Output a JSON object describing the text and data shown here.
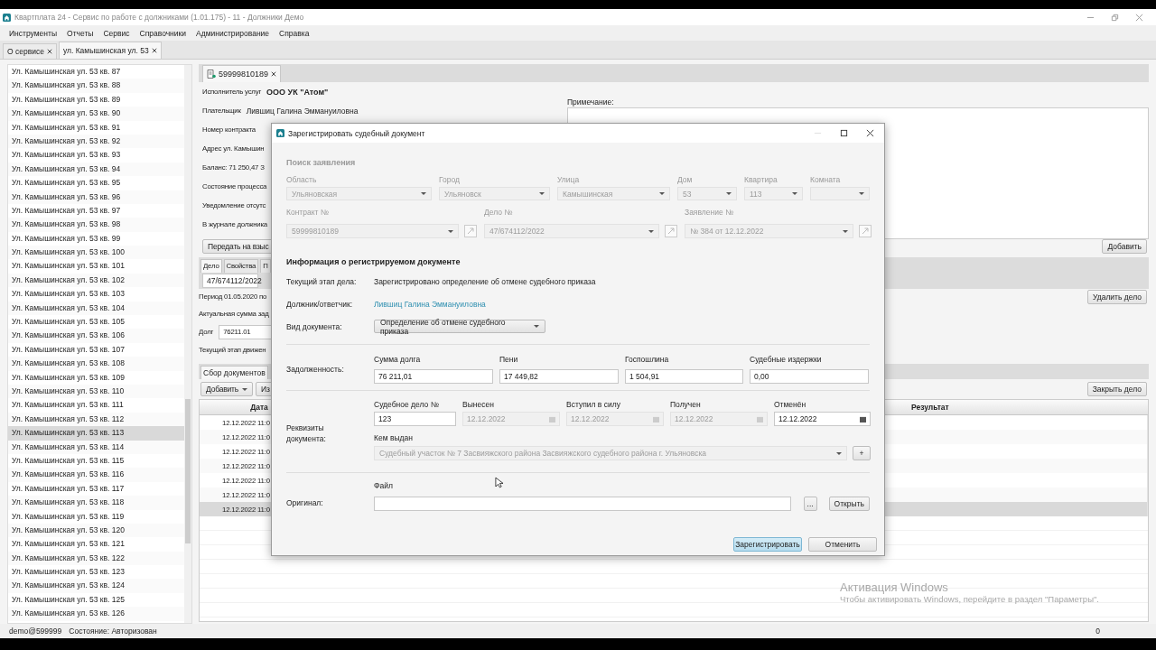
{
  "window": {
    "title": "Квартплата 24 - Сервис по работе с должниками (1.01.175) - 11 - Должники Демо",
    "menu": [
      "Инструменты",
      "Отчеты",
      "Сервис",
      "Справочники",
      "Администрирование",
      "Справка"
    ]
  },
  "tabs": [
    {
      "label": "О сервисе",
      "selected": false
    },
    {
      "label": "ул. Камышинская ул. 53",
      "selected": true
    }
  ],
  "address_list": [
    {
      "label": "Ул. Камышинская ул. 53 кв. 87",
      "selected": false
    },
    {
      "label": "Ул. Камышинская ул. 53 кв. 88",
      "selected": false
    },
    {
      "label": "Ул. Камышинская ул. 53 кв. 89",
      "selected": false
    },
    {
      "label": "Ул. Камышинская ул. 53 кв. 90",
      "selected": false
    },
    {
      "label": "Ул. Камышинская ул. 53 кв. 91",
      "selected": false
    },
    {
      "label": "Ул. Камышинская ул. 53 кв. 92",
      "selected": false
    },
    {
      "label": "Ул. Камышинская ул. 53 кв. 93",
      "selected": false
    },
    {
      "label": "Ул. Камышинская ул. 53 кв. 94",
      "selected": false
    },
    {
      "label": "Ул. Камышинская ул. 53 кв. 95",
      "selected": false
    },
    {
      "label": "Ул. Камышинская ул. 53 кв. 96",
      "selected": false
    },
    {
      "label": "Ул. Камышинская ул. 53 кв. 97",
      "selected": false
    },
    {
      "label": "Ул. Камышинская ул. 53 кв. 98",
      "selected": false
    },
    {
      "label": "Ул. Камышинская ул. 53 кв. 99",
      "selected": false
    },
    {
      "label": "Ул. Камышинская ул. 53 кв. 100",
      "selected": false
    },
    {
      "label": "Ул. Камышинская ул. 53 кв. 101",
      "selected": false
    },
    {
      "label": "Ул. Камышинская ул. 53 кв. 102",
      "selected": false
    },
    {
      "label": "Ул. Камышинская ул. 53 кв. 103",
      "selected": false
    },
    {
      "label": "Ул. Камышинская ул. 53 кв. 104",
      "selected": false
    },
    {
      "label": "Ул. Камышинская ул. 53 кв. 105",
      "selected": false
    },
    {
      "label": "Ул. Камышинская ул. 53 кв. 106",
      "selected": false
    },
    {
      "label": "Ул. Камышинская ул. 53 кв. 107",
      "selected": false
    },
    {
      "label": "Ул. Камышинская ул. 53 кв. 108",
      "selected": false
    },
    {
      "label": "Ул. Камышинская ул. 53 кв. 109",
      "selected": false
    },
    {
      "label": "Ул. Камышинская ул. 53 кв. 110",
      "selected": false
    },
    {
      "label": "Ул. Камышинская ул. 53 кв. 111",
      "selected": false
    },
    {
      "label": "Ул. Камышинская ул. 53 кв. 112",
      "selected": false
    },
    {
      "label": "Ул. Камышинская ул. 53 кв. 113",
      "selected": true
    },
    {
      "label": "Ул. Камышинская ул. 53 кв. 114",
      "selected": false
    },
    {
      "label": "Ул. Камышинская ул. 53 кв. 115",
      "selected": false
    },
    {
      "label": "Ул. Камышинская ул. 53 кв. 116",
      "selected": false
    },
    {
      "label": "Ул. Камышинская ул. 53 кв. 117",
      "selected": false
    },
    {
      "label": "Ул. Камышинская ул. 53 кв. 118",
      "selected": false
    },
    {
      "label": "Ул. Камышинская ул. 53 кв. 119",
      "selected": false
    },
    {
      "label": "Ул. Камышинская ул. 53 кв. 120",
      "selected": false
    },
    {
      "label": "Ул. Камышинская ул. 53 кв. 121",
      "selected": false
    },
    {
      "label": "Ул. Камышинская ул. 53 кв. 122",
      "selected": false
    },
    {
      "label": "Ул. Камышинская ул. 53 кв. 123",
      "selected": false
    },
    {
      "label": "Ул. Камышинская ул. 53 кв. 124",
      "selected": false
    },
    {
      "label": "Ул. Камышинская ул. 53 кв. 125",
      "selected": false
    },
    {
      "label": "Ул. Камышинская ул. 53 кв. 126",
      "selected": false
    }
  ],
  "document_tab": {
    "label": "59999810189"
  },
  "info_lines": [
    {
      "label": "Исполнитель услуг",
      "value": "ООО УК \"Атом\""
    },
    {
      "label": "Плательщик",
      "value": "Лившиц Галина Эммануиловна"
    },
    {
      "label": "Номер контракта"
    },
    {
      "label": "Адрес  ул. Камышин"
    },
    {
      "label": "Баланс: 71 250,47  З"
    },
    {
      "label": "Состояние процесса"
    },
    {
      "label": "Уведомление отсутс"
    },
    {
      "label": "В журнале должника"
    }
  ],
  "send_button": "Передать на взыс",
  "note": {
    "label": "Примечание:",
    "add_button": "Добавить"
  },
  "case_tabs": [
    {
      "label": "Дело",
      "selected": true
    },
    {
      "label": "Свойства",
      "selected": false
    },
    {
      "label": "П",
      "selected": false
    }
  ],
  "case_number": "47/674112/2022",
  "period": "Период  01.05.2020  по",
  "delete_button": "Удалить дело",
  "actual_sum": "Актуальная сумма зад",
  "debt": {
    "label": "Долг",
    "value": "76211.01"
  },
  "stage": "Текущий этап движен",
  "stage_tabs": [
    {
      "label": "Сбор документов",
      "selected": true
    }
  ],
  "toolbar": {
    "add": "Добавить",
    "edit": "Из",
    "close_case": "Закрыть дело"
  },
  "table": {
    "date_header": "Дата",
    "result_header": "Результат",
    "rows": [
      {
        "date": "12.12.2022 11:0",
        "selected": false
      },
      {
        "date": "12.12.2022 11:0",
        "selected": false
      },
      {
        "date": "12.12.2022 11:0",
        "selected": false
      },
      {
        "date": "12.12.2022 11:0",
        "selected": false
      },
      {
        "date": "12.12.2022 11:0",
        "selected": false
      },
      {
        "date": "12.12.2022 11:0",
        "selected": false
      },
      {
        "date": "12.12.2022 11:0",
        "selected": true
      }
    ]
  },
  "status_bar": {
    "user": "demo@599999",
    "state": "Состояние: Авторизован",
    "count": "0"
  },
  "activation": {
    "title": "Активация Windows",
    "text": "Чтобы активировать Windows, перейдите в раздел \"Параметры\"."
  },
  "dialog": {
    "title": "Зарегистрировать судебный документ",
    "search": {
      "heading": "Поиск заявления",
      "disabled": true,
      "fields": [
        {
          "label": "Область",
          "value": "Ульяновская"
        },
        {
          "label": "Город",
          "value": "Ульяновск"
        },
        {
          "label": "Улица",
          "value": "Камышинская"
        },
        {
          "label": "Дом",
          "value": "53"
        },
        {
          "label": "Квартира",
          "value": "113"
        },
        {
          "label": "Комната"
        }
      ],
      "links": [
        {
          "label": "Контракт №",
          "value": "59999810189"
        },
        {
          "label": "Дело №",
          "value": "47/674112/2022"
        },
        {
          "label": "Заявление №",
          "value": "№ 384 от 12.12.2022"
        }
      ]
    },
    "info": {
      "heading": "Информация о регистрируемом документе",
      "stage_label": "Текущий этап дела:",
      "stage": "Зарегистрировано определение об отмене судебного приказа",
      "debtor_label": "Должник/ответчик:",
      "debtor": "Лившиц Галина Эммануиловна",
      "doc_type_label": "Вид документа:",
      "doc_type": "Определение об отмене судебного приказа"
    },
    "debt": {
      "label": "Задолженность:",
      "fields": [
        {
          "label": "Сумма долга",
          "value": "76 211,01"
        },
        {
          "label": "Пени",
          "value": "17 449,82"
        },
        {
          "label": "Госпошлина",
          "value": "1 504,91"
        },
        {
          "label": "Судебные издержки",
          "value": "0,00"
        }
      ]
    },
    "requisites": {
      "label": "Реквизиты документа:",
      "case_no": {
        "label": "Судебное дело №",
        "value": "123"
      },
      "dates": [
        {
          "label": "Вынесен",
          "value": "12.12.2022",
          "disabled": true
        },
        {
          "label": "Вступил в силу",
          "value": "12.12.2022",
          "disabled": true
        },
        {
          "label": "Получен",
          "value": "12.12.2022",
          "disabled": true
        },
        {
          "label": "Отменён",
          "value": "12.12.2022",
          "disabled": false
        }
      ],
      "issuer": {
        "label": "Кем выдан",
        "value": "Судебный участок № 7 Засвияжского района Засвияжского судебного района г. Ульяновска",
        "disabled": true
      },
      "add_symbol": "+"
    },
    "original": {
      "label": "Оригинал:",
      "file_label": "Файл",
      "browse": "...",
      "open": "Открыть"
    },
    "buttons": [
      {
        "label": "Зарегистрировать",
        "default": true
      },
      {
        "label": "Отменить",
        "default": false
      }
    ]
  }
}
